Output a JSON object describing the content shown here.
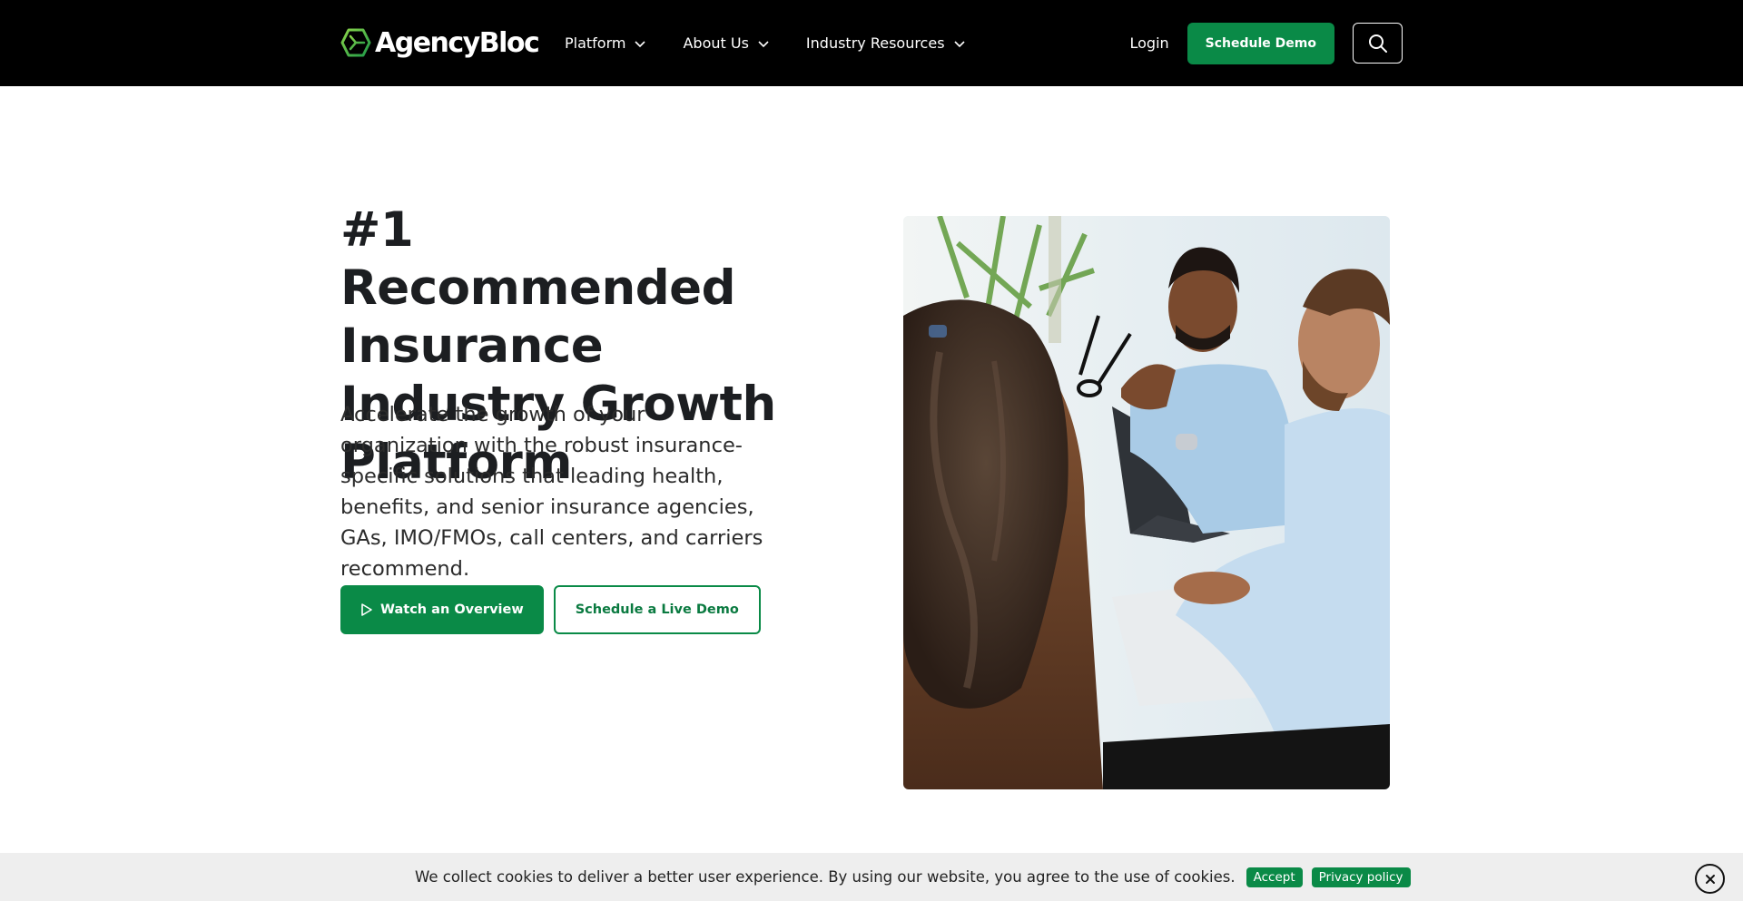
{
  "brand": {
    "name": "AgencyBloc",
    "logo_icon": "hexagon-cube-icon",
    "accent_color": "#0a8a47",
    "logo_green": "#5cc04a"
  },
  "nav": {
    "menu": [
      {
        "label": "Platform",
        "icon": "chevron-down-icon"
      },
      {
        "label": "About Us",
        "icon": "chevron-down-icon"
      },
      {
        "label": "Industry Resources",
        "icon": "chevron-down-icon"
      }
    ],
    "login_label": "Login",
    "cta_label": "Schedule Demo",
    "search_icon": "search-icon"
  },
  "hero": {
    "title": "#1 Recommended Insurance Industry Growth Platform",
    "description": "Accelerate the growth of your organization with the robust insurance-specific solutions that leading health, benefits, and senior insurance agencies, GAs, IMO/FMOs, call centers, and carriers recommend.",
    "primary_button": {
      "label": "Watch an Overview",
      "icon": "play-icon"
    },
    "secondary_button": {
      "label": "Schedule a Live Demo"
    },
    "photo_alt": "Business professionals meeting at a table with laptops"
  },
  "cookie_banner": {
    "text": "We collect cookies to deliver a better user experience. By using our website, you agree to the use of cookies.",
    "accept_label": "Accept",
    "privacy_label": "Privacy policy",
    "close_icon": "close-icon"
  }
}
